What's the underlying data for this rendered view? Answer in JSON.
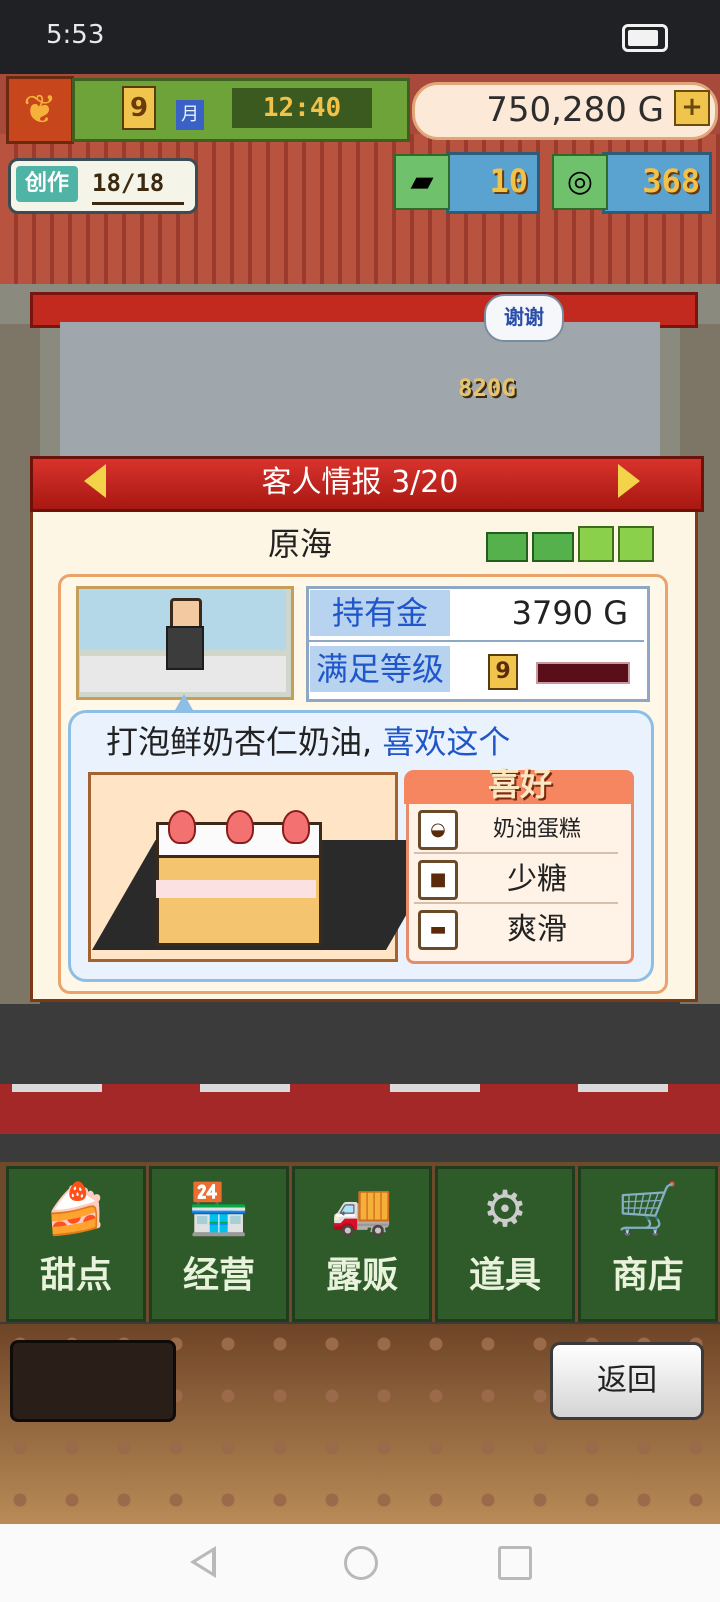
{
  "status_bar": {
    "time": "5:53",
    "battery_icon": "battery-icon"
  },
  "hud": {
    "season_icon": "maple-leaf-icon",
    "month": "9",
    "month_label": "月",
    "clock": "12:40",
    "money": "750,280 G",
    "add_money_icon": "plus-icon",
    "create_label": "创作",
    "create_value": "18/18",
    "resources": [
      {
        "icon": "gold-bar-icon",
        "value": "10"
      },
      {
        "icon": "silver-medal-icon",
        "value": "368"
      }
    ]
  },
  "scene": {
    "thanks_bubble": "谢谢",
    "income_float": "820G"
  },
  "customer_panel": {
    "title": "客人情报 3/20",
    "name": "原海",
    "cash_icons": 2,
    "gift_icons": 2,
    "stats": {
      "money_label": "持有金",
      "money_value": "3790 G",
      "satisfaction_label": "满足等级",
      "satisfaction_value": "9"
    },
    "comment_prefix": "打泡鲜奶杏仁奶油,",
    "comment_highlight": " 喜欢这个",
    "dish_image": "strawberry-shortcake",
    "preferences": {
      "title": "喜好",
      "items": [
        {
          "icon": "cake-icon",
          "label": "奶油蛋糕"
        },
        {
          "icon": "sugar-square-icon",
          "label": "少糖"
        },
        {
          "icon": "smooth-bar-icon",
          "label": "爽滑"
        }
      ]
    }
  },
  "menu": [
    {
      "id": "dessert",
      "label": "甜点",
      "icon": "cake-menu-icon",
      "glyph": "🍰"
    },
    {
      "id": "manage",
      "label": "经营",
      "icon": "shop-menu-icon",
      "glyph": "🏪"
    },
    {
      "id": "stall",
      "label": "露贩",
      "icon": "truck-menu-icon",
      "glyph": "🚚"
    },
    {
      "id": "items",
      "label": "道具",
      "icon": "gear-bag-menu-icon",
      "glyph": "⚙"
    },
    {
      "id": "store",
      "label": "商店",
      "icon": "cart-menu-icon",
      "glyph": "🛒"
    }
  ],
  "footer": {
    "back_label": "返回"
  },
  "colors": {
    "panel_header": "#c8221b",
    "highlight_text": "#1f56c9",
    "menu_green": "#2f5a2a"
  }
}
